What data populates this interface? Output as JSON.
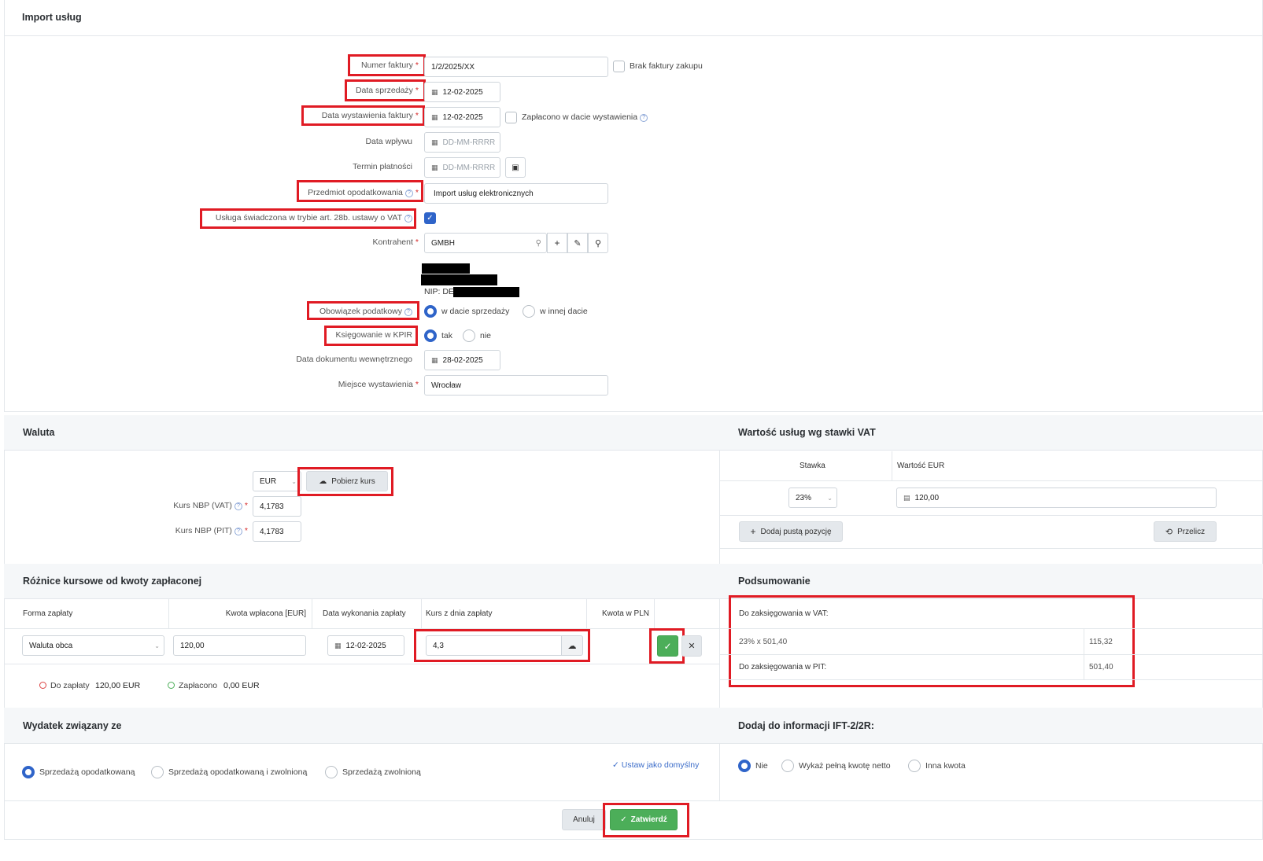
{
  "header": {
    "title": "Import usług"
  },
  "form": {
    "invoice_number": {
      "label": "Numer faktury",
      "value": "1/2/2025/XX"
    },
    "no_purchase_invoice": {
      "label": "Brak faktury zakupu"
    },
    "sale_date": {
      "label": "Data sprzedaży",
      "value": "12-02-2025"
    },
    "issue_date": {
      "label": "Data wystawienia faktury",
      "value": "12-02-2025"
    },
    "paid_on_issue": {
      "label": "Zapłacono w dacie wystawienia"
    },
    "receipt_date": {
      "label": "Data wpływu",
      "placeholder": "DD-MM-RRRR"
    },
    "payment_due": {
      "label": "Termin płatności",
      "placeholder": "DD-MM-RRRR"
    },
    "tax_subject": {
      "label": "Przedmiot opodatkowania",
      "value": "Import usług elektronicznych"
    },
    "art28b": {
      "label": "Usługa świadczona w trybie art. 28b. ustawy o VAT",
      "checked": true
    },
    "contractor": {
      "label": "Kontrahent",
      "value": "GMBH",
      "nip_prefix": "NIP: DE"
    },
    "tax_obligation": {
      "label": "Obowiązek podatkowy",
      "options": [
        "w dacie sprzedaży",
        "w innej dacie"
      ],
      "selected": 0
    },
    "kpir": {
      "label": "Księgowanie w KPIR",
      "options": [
        "tak",
        "nie"
      ],
      "selected": 0
    },
    "internal_doc_date": {
      "label": "Data dokumentu wewnętrznego",
      "value": "28-02-2025"
    },
    "issue_place": {
      "label": "Miejsce wystawienia",
      "value": "Wrocław"
    }
  },
  "currency": {
    "title": "Waluta",
    "selected": "EUR",
    "fetch_rate": "Pobierz kurs",
    "nbp_vat": {
      "label": "Kurs NBP (VAT)",
      "value": "4,1783"
    },
    "nbp_pit": {
      "label": "Kurs NBP (PIT)",
      "value": "4,1783"
    }
  },
  "vat_values": {
    "title": "Wartość usług wg stawki VAT",
    "col_rate": "Stawka",
    "col_value": "Wartość EUR",
    "rate": "23%",
    "value": "120,00",
    "add_empty": "Dodaj pustą pozycję",
    "recalc": "Przelicz"
  },
  "fx_diff": {
    "title": "Różnice kursowe od kwoty zapłaconej",
    "headers": [
      "Forma zapłaty",
      "Kwota wpłacona [EUR]",
      "Data wykonania zapłaty",
      "Kurs z dnia zapłaty",
      "Kwota w PLN"
    ],
    "payment_form": "Waluta obca",
    "amount": "120,00",
    "date": "12-02-2025",
    "rate": "4,3",
    "to_pay_label": "Do zapłaty",
    "to_pay_value": "120,00 EUR",
    "paid_label": "Zapłacono",
    "paid_value": "0,00 EUR"
  },
  "summary": {
    "title": "Podsumowanie",
    "vat_label": "Do zaksięgowania w VAT:",
    "vat_row": "23% x 501,40",
    "vat_value": "115,32",
    "pit_label": "Do zaksięgowania w PIT:",
    "pit_value": "501,40"
  },
  "expense": {
    "title": "Wydatek związany ze",
    "options": [
      "Sprzedażą opodatkowaną",
      "Sprzedażą opodatkowaną i zwolnioną",
      "Sprzedażą zwolnioną"
    ],
    "selected": 0,
    "set_default": "Ustaw jako domyślny"
  },
  "ift": {
    "title": "Dodaj do informacji IFT-2/2R:",
    "options": [
      "Nie",
      "Wykaż pełną kwotę netto",
      "Inna kwota"
    ],
    "selected": 0
  },
  "footer": {
    "cancel": "Anuluj",
    "confirm": "Zatwierdź"
  },
  "colors": {
    "accent": "#2f64c9",
    "green": "#4cae59",
    "highlight": "#e01b24"
  }
}
